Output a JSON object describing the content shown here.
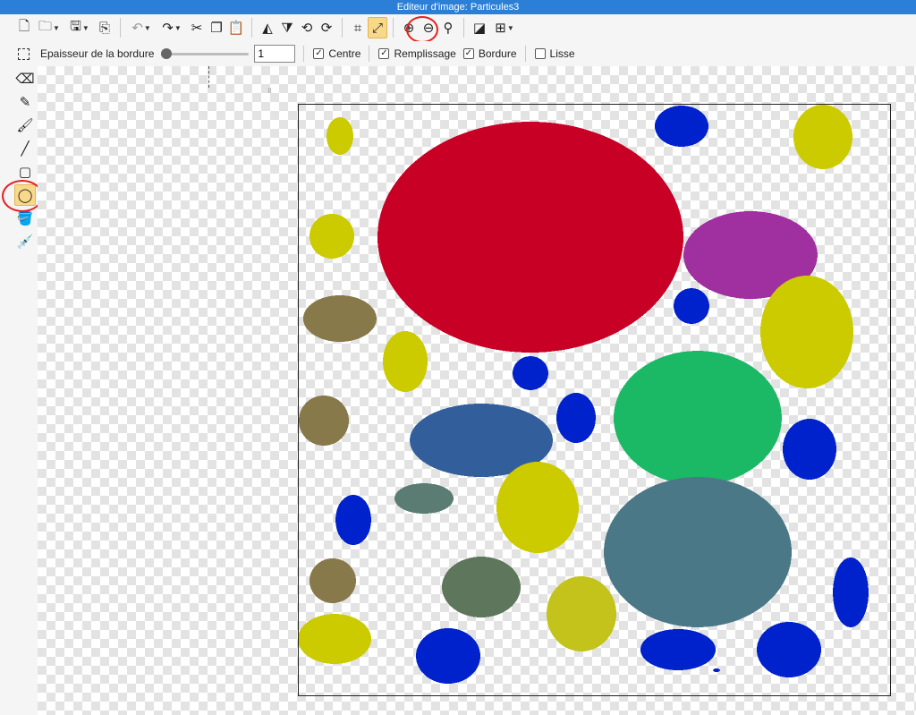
{
  "window": {
    "title": "Editeur d'image: Particules3"
  },
  "toolbar": {
    "new_icon": "new-file-icon",
    "open_icon": "folder-icon",
    "save_icon": "save-icon",
    "export_icon": "export-icon",
    "undo_icon": "undo-icon",
    "redo_icon": "redo-icon",
    "cut_icon": "scissors-icon",
    "copy_icon": "copy-icon",
    "paste_icon": "paste-icon",
    "flip_h_icon": "flip-horizontal-icon",
    "flip_v_icon": "flip-vertical-icon",
    "rotate_left_icon": "rotate-left-icon",
    "rotate_right_icon": "rotate-right-icon",
    "crop_icon": "crop-icon",
    "resize_icon": "resize-icon",
    "zoom_in_icon": "zoom-in-icon",
    "zoom_out_icon": "zoom-out-icon",
    "zoom_fit_icon": "zoom-icon",
    "contrast_icon": "contrast-icon",
    "grid_icon": "grid-icon"
  },
  "options": {
    "border_label": "Epaisseur de la bordure",
    "border_value": "1",
    "border_slider_fraction": 0.0,
    "centre_label": "Centre",
    "centre_checked": true,
    "fill_label": "Remplissage",
    "fill_checked": true,
    "border_chk_label": "Bordure",
    "border_checked": true,
    "smooth_label": "Lisse",
    "smooth_checked": false
  },
  "tools": [
    {
      "name": "eraser-icon",
      "active": false
    },
    {
      "name": "pencil-icon",
      "active": false
    },
    {
      "name": "brush-icon",
      "active": false
    },
    {
      "name": "line-icon",
      "active": false
    },
    {
      "name": "rectangle-icon",
      "active": false
    },
    {
      "name": "ellipse-icon",
      "active": true
    },
    {
      "name": "fill-bucket-icon",
      "active": false
    },
    {
      "name": "eyedropper-icon",
      "active": false
    }
  ],
  "colors": {
    "titlebar": "#2b7fd6",
    "annotation": "#e8201e",
    "active_tool": "#f8d98a"
  },
  "particles": [
    {
      "color": "#c80026"
    },
    {
      "color": "#cbcb00"
    },
    {
      "color": "#0022cc"
    },
    {
      "color": "#a02fa0"
    },
    {
      "color": "#1bb866"
    },
    {
      "color": "#325f9b"
    },
    {
      "color": "#4a7887"
    },
    {
      "color": "#88794a"
    },
    {
      "color": "#5e765b"
    },
    {
      "color": "#5a7c72"
    },
    {
      "color": "#c3c31b"
    }
  ]
}
